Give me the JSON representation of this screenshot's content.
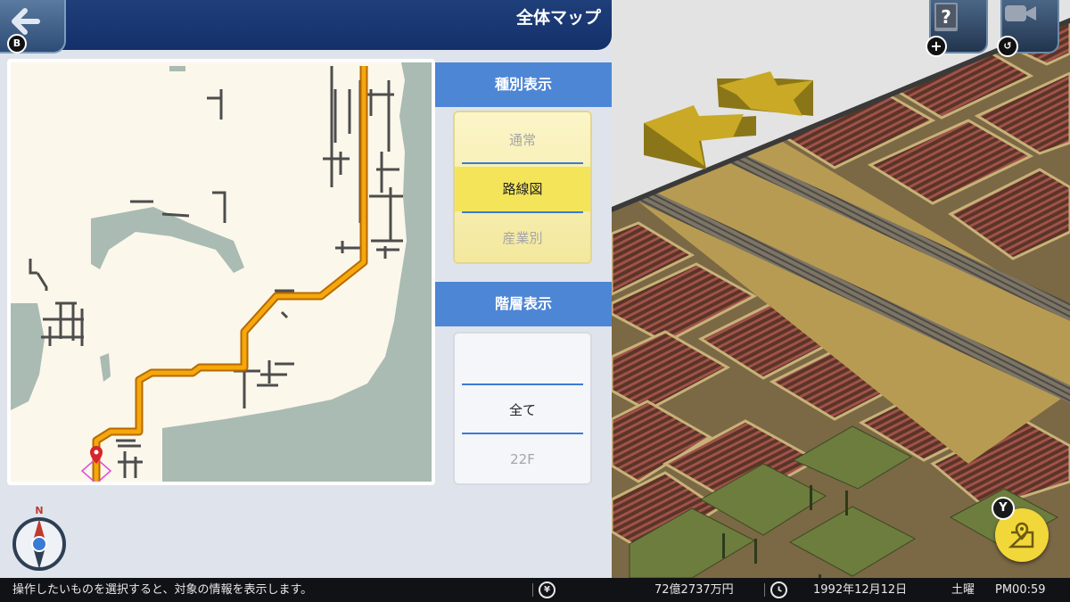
{
  "header": {
    "title": "全体マップ",
    "back_badge": "B"
  },
  "type_display": {
    "heading": "種別表示",
    "options": [
      "通常",
      "路線図",
      "産業別"
    ],
    "selected": "路線図"
  },
  "floor_display": {
    "heading": "階層表示",
    "options": [
      "",
      "全て",
      "22F"
    ],
    "selected": "全て"
  },
  "compass": {
    "north_label": "N"
  },
  "top_right_buttons": {
    "help_icon": "help-book-icon",
    "help_badge": "+",
    "camera_icon": "video-camera-icon",
    "camera_badge": "↺"
  },
  "map_button": {
    "badge": "Y",
    "icon": "map-pin-icon"
  },
  "status_bar": {
    "message": "操作したいものを選択すると、対象の情報を表示します。",
    "currency_icon": "¥",
    "money": "72億2737万円",
    "date": "1992年12月12日",
    "weekday": "土曜",
    "time": "PM00:59"
  },
  "colors": {
    "route_line": "#f5a70c",
    "map_land": "#fbf7ea",
    "map_water": "#a9bbb3",
    "header_bg": "#14306a",
    "selected_option": "#f4e45a",
    "map_button": "#f2d73a"
  }
}
